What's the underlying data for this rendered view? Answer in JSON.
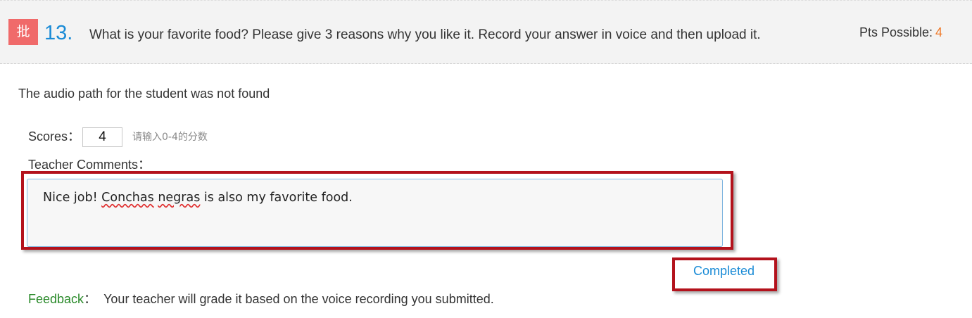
{
  "question": {
    "badge": "批",
    "number": "13.",
    "text": "What is your favorite food? Please give 3 reasons why you like it. Record your answer in voice and then upload it.",
    "pts_label": "Pts Possible:",
    "pts_value": "4"
  },
  "audio_message": "The audio path for the student was not found",
  "score": {
    "label": "Scores：",
    "value": "4",
    "hint": "请输入0-4的分数"
  },
  "comments": {
    "label": "Teacher Comments：",
    "text_before": "Nice job! ",
    "misspelled_1": "Conchas",
    "space": " ",
    "misspelled_2": "negras",
    "text_after": " is also my favorite food."
  },
  "status": {
    "label": "Completed"
  },
  "feedback": {
    "label": "Feedback",
    "colon": "：",
    "text": "Your teacher will grade it based on the voice recording you submitted."
  },
  "colors": {
    "accent_blue": "#1a8bd6",
    "badge_red": "#f06a6a",
    "points_orange": "#f07a2a",
    "highlight_red": "#b3121c",
    "feedback_green": "#2a8a2a"
  }
}
